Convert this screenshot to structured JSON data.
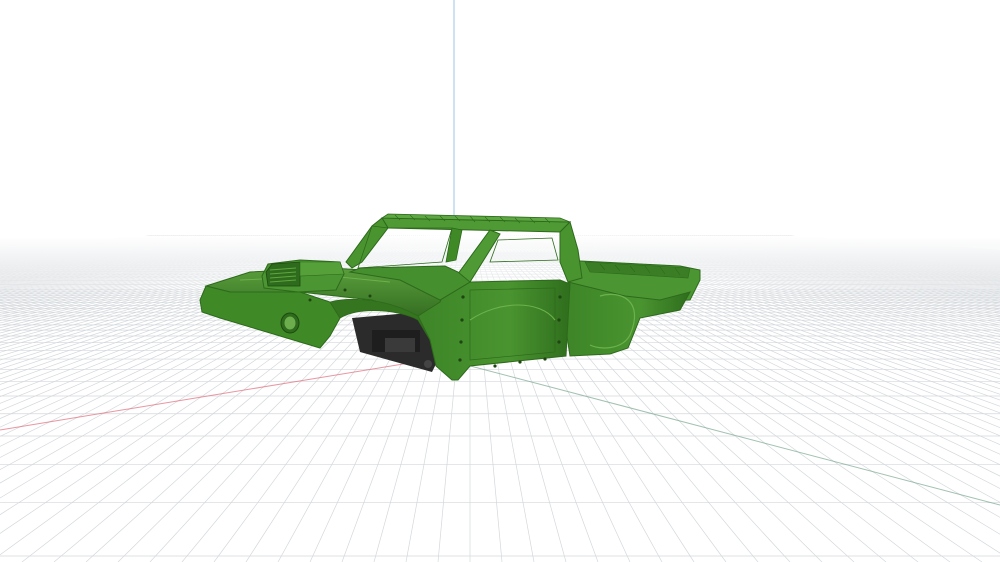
{
  "viewport": {
    "background": "#ffffff",
    "grid_color": "#d4d8dc",
    "x_axis_color": "#e06a7a",
    "y_axis_color": "#7aa890",
    "z_axis_color": "#9bc4e6"
  },
  "model": {
    "body_color": "#3f8a27",
    "body_shade_color": "#2e6b1c",
    "body_highlight_color": "#62a843",
    "chassis_color": "#2b2b2b"
  }
}
